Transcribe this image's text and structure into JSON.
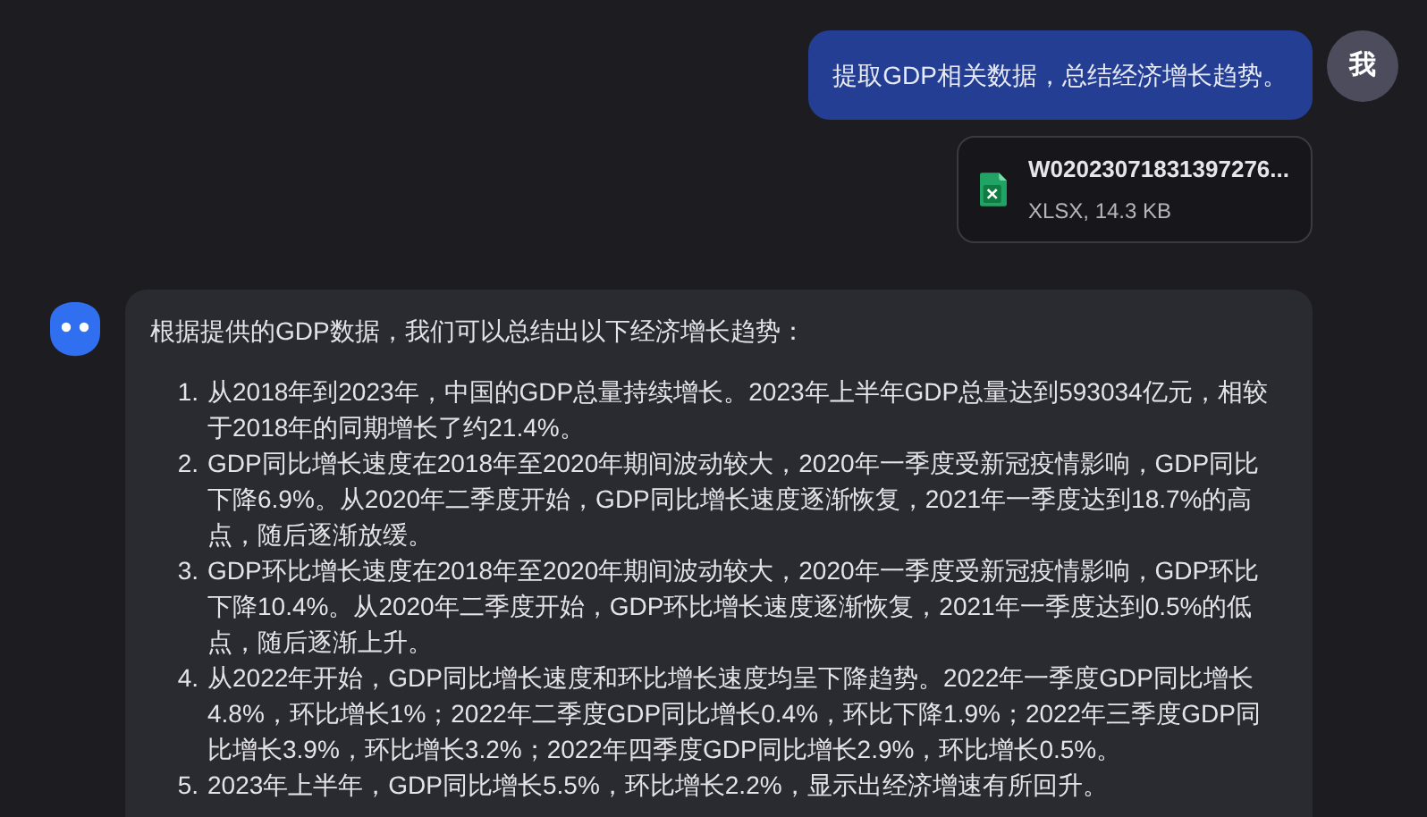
{
  "user_message": {
    "text": "提取GDP相关数据，总结经济增长趋势。",
    "avatar": "我"
  },
  "attachment": {
    "file_name": "W02023071831397276...",
    "meta": "XLSX, 14.3 KB"
  },
  "assistant_message": {
    "intro": "根据提供的GDP数据，我们可以总结出以下经济增长趋势：",
    "items": [
      {
        "number": "1.",
        "text": "从2018年到2023年，中国的GDP总量持续增长。2023年上半年GDP总量达到593034亿元，相较于2018年的同期增长了约21.4%。"
      },
      {
        "number": "2.",
        "text": "GDP同比增长速度在2018年至2020年期间波动较大，2020年一季度受新冠疫情影响，GDP同比下降6.9%。从2020年二季度开始，GDP同比增长速度逐渐恢复，2021年一季度达到18.7%的高点，随后逐渐放缓。"
      },
      {
        "number": "3.",
        "text": "GDP环比增长速度在2018年至2020年期间波动较大，2020年一季度受新冠疫情影响，GDP环比下降10.4%。从2020年二季度开始，GDP环比增长速度逐渐恢复，2021年一季度达到0.5%的低点，随后逐渐上升。"
      },
      {
        "number": "4.",
        "text": "从2022年开始，GDP同比增长速度和环比增长速度均呈下降趋势。2022年一季度GDP同比增长4.8%，环比增长1%；2022年二季度GDP同比增长0.4%，环比下降1.9%；2022年三季度GDP同比增长3.9%，环比增长3.2%；2022年四季度GDP同比增长2.9%，环比增长0.5%。"
      },
      {
        "number": "5.",
        "text": "2023年上半年，GDP同比增长5.5%，环比增长2.2%，显示出经济增速有所回升。"
      }
    ]
  }
}
